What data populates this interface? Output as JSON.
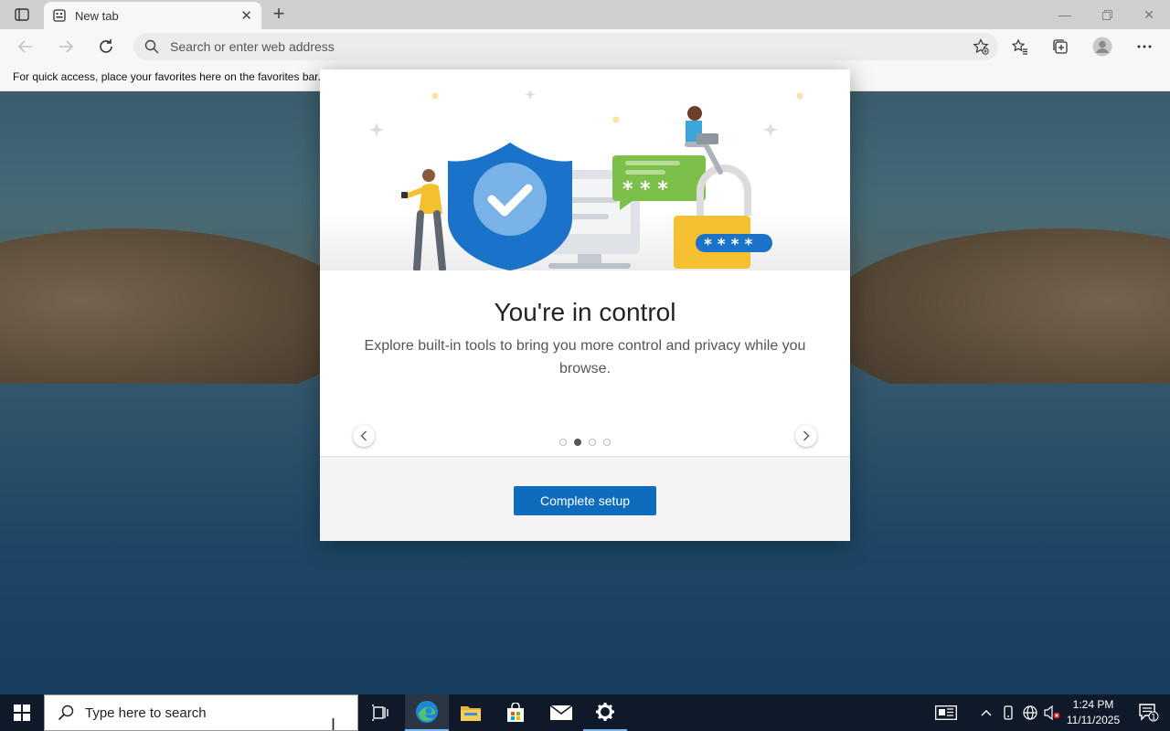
{
  "browser": {
    "tab": {
      "title": "New tab"
    },
    "address": {
      "placeholder": "Search or enter web address"
    },
    "favorites_bar_text": "For quick access, place your favorites here on the favorites bar."
  },
  "modal": {
    "title": "You're in control",
    "description": "Explore built-in tools to bring you more control and privacy while you browse.",
    "carousel": {
      "page_count": 4,
      "active_page": 2
    },
    "primary_button": "Complete setup",
    "illustration_masks": {
      "chat": "* * *",
      "lock": "* * * *"
    }
  },
  "taskbar": {
    "search_placeholder": "Type here to search",
    "clock_time": "1:24 PM",
    "clock_date": "11/11/2025",
    "notification_count": "1",
    "apps": [
      "task-view-icon",
      "edge-icon",
      "file-explorer-icon",
      "store-icon",
      "mail-icon",
      "settings-icon"
    ]
  },
  "colors": {
    "accent": "#0f6cbd",
    "taskbar": "#10192a",
    "shield": "#1a73c8",
    "chat_green": "#7cbf4a",
    "lock_yellow": "#f5c030"
  }
}
